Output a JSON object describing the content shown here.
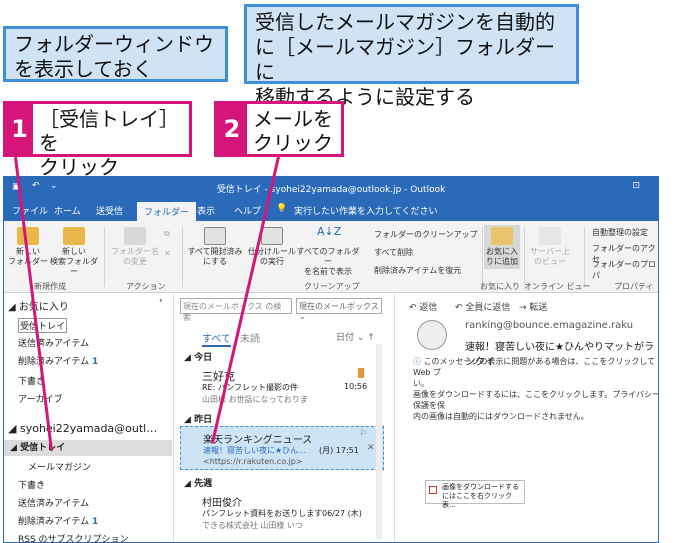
{
  "callouts": {
    "left": [
      "フォルダーウィンドウ",
      "を表示しておく"
    ],
    "right": [
      "受信したメールマガジンを自動的",
      "に［メールマガジン］フォルダーに",
      "移動するように設定する"
    ]
  },
  "steps": [
    {
      "num": "1",
      "lines": [
        "［受信トレイ］を",
        "クリック"
      ]
    },
    {
      "num": "2",
      "lines": [
        "メールを",
        "クリック"
      ]
    }
  ],
  "window": {
    "title": "受信トレイ - syohei22yamada@outlook.jp - Outlook",
    "tabs": [
      "ファイル",
      "ホーム",
      "送受信",
      "フォルダー",
      "表示",
      "ヘルプ"
    ],
    "tellme": "実行したい作業を入力してください",
    "ribbon": {
      "buttons": [
        {
          "label": "新しい\nフォルダー",
          "color": "#e8b84a"
        },
        {
          "label": "新しい\n検索フォルダー",
          "color": "#e8b84a"
        },
        {
          "label": "フォルダー名\nの変更",
          "color": "#cfcfcf"
        },
        {
          "label": "すべて開封済み\nにする",
          "color": "#dcdcdc"
        },
        {
          "label": "仕分けルール\nの実行",
          "color": "#dcdcdc"
        },
        {
          "label": "すべてのフォルダー\nを名前で表示",
          "color": "#dcdcdc"
        },
        {
          "label": "お気に入\nりに追加",
          "color": "#e8c46a"
        },
        {
          "label": "サーバー上\nのビュー",
          "color": "#dcdcdc"
        }
      ],
      "small": [
        "フォルダーのクリーンアップ",
        "すべて削除",
        "削除済みアイテムを復元"
      ],
      "right": [
        "自動整理の設定",
        "フォルダーのアクセ",
        "フォルダーのプロパ"
      ],
      "groups": [
        "新規作成",
        "アクション",
        "クリーンアップ",
        "お気に入り",
        "オンライン ビュー",
        "プロパティ"
      ]
    },
    "nav": {
      "fav_header": "お気に入り",
      "fav": [
        {
          "label": "受信トレイ",
          "count": ""
        },
        {
          "label": "送信済みアイテム",
          "count": ""
        },
        {
          "label": "削除済みアイテム",
          "count": "1"
        },
        {
          "label": "下書き",
          "count": ""
        },
        {
          "label": "アーカイブ",
          "count": ""
        }
      ],
      "account": "syohei22yamada@outl…",
      "folders": [
        {
          "label": "受信トレイ",
          "count": ""
        },
        {
          "label": "メールマガジン",
          "count": ""
        },
        {
          "label": "下書き",
          "count": ""
        },
        {
          "label": "送信済みアイテム",
          "count": ""
        },
        {
          "label": "削除済みアイテム",
          "count": "1"
        },
        {
          "label": "RSS のサブスクリプション",
          "count": ""
        }
      ]
    },
    "list": {
      "search_placeholder": "現在のメールボックス の検索",
      "scope": "現在のメールボックス",
      "filter_all": "すべて",
      "filter_unread": "未読",
      "sort": "日付",
      "groups": [
        "今日",
        "昨日",
        "先週"
      ],
      "items": [
        {
          "from": "三好克",
          "subject": "RE: パンフレット撮影の件",
          "preview": "山田様 お世話になっておりま",
          "time": "10:56"
        },
        {
          "from": "楽天ランキングニュース",
          "subject": "速報！寝苦しい夜に★ひん…",
          "preview": "<https://r.rakuten.co.jp>",
          "time": "(月) 17:51"
        },
        {
          "from": "村田俊介",
          "subject": "パンフレット資料をお送りします",
          "preview": "できる株式会社 山田様 いつ",
          "time": "06/27 (木)"
        }
      ]
    },
    "reading": {
      "actions": [
        "返信",
        "全員に返信",
        "転送"
      ],
      "sender": "ranking@bounce.emagazine.raku",
      "subject": "速報！寝苦しい夜に★ひんやりマットがランクイ",
      "notice1": "このメッセージの表示に問題がある場合は、ここをクリックして Web ブ",
      "notice2": "い。",
      "notice3": "画像をダウンロードするには、ここをクリックします。プライバシー保護を保",
      "notice4": "内の画像は自動的にはダウンロードされません。",
      "img_text": "画像をダウンロードする\nにはここを右クリック表…"
    }
  }
}
